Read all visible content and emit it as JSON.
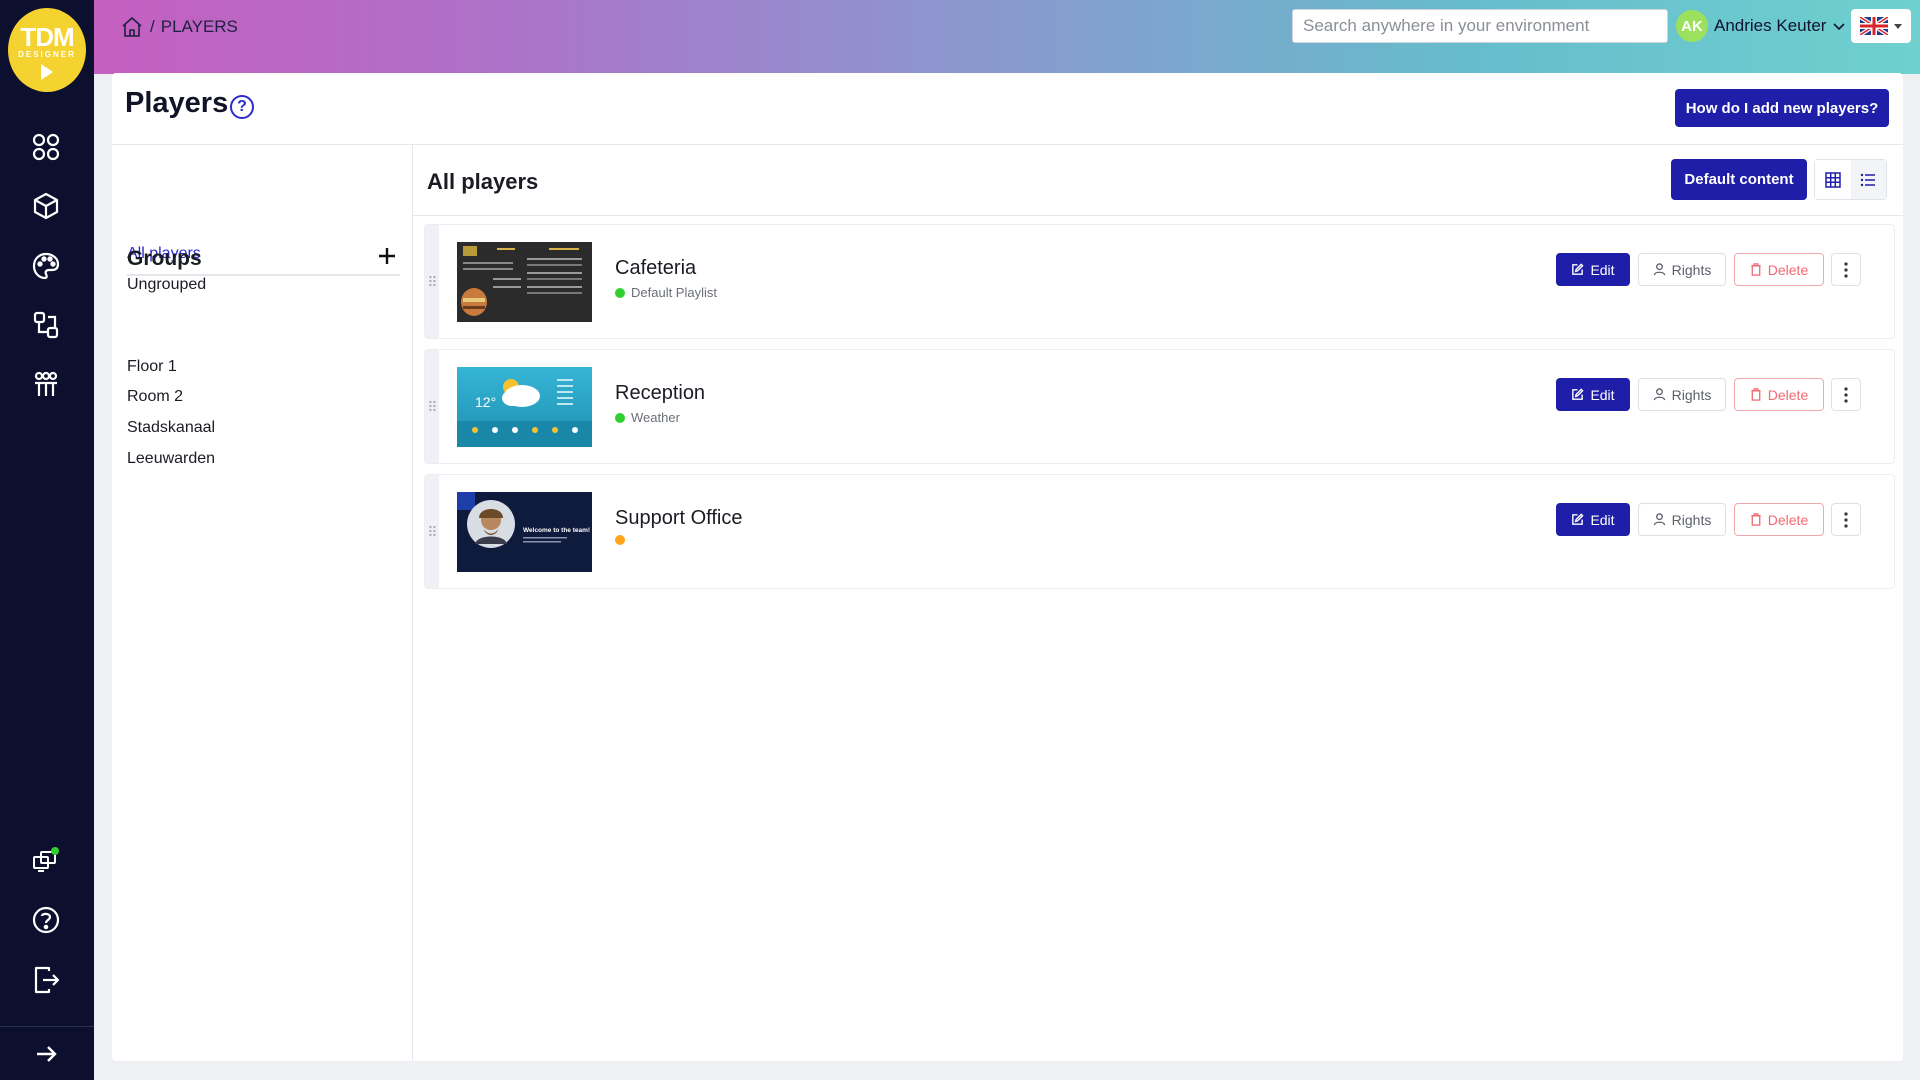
{
  "app": {
    "logo": {
      "line1": "TDM",
      "line2": "DESIGNER"
    },
    "breadcrumb": {
      "separator": "/",
      "current": "PLAYERS"
    },
    "search": {
      "placeholder": "Search anywhere in your environment",
      "value": ""
    },
    "user": {
      "initials": "AK",
      "name": "Andries Keuter"
    },
    "language": "en-GB"
  },
  "sidebar": {
    "items": [
      {
        "name": "dashboard",
        "icon": "grid-circles-icon"
      },
      {
        "name": "content",
        "icon": "cube-icon"
      },
      {
        "name": "design",
        "icon": "palette-icon"
      },
      {
        "name": "players",
        "icon": "players-icon"
      },
      {
        "name": "users",
        "icon": "team-icon"
      }
    ],
    "bottom": [
      {
        "name": "devices",
        "icon": "devices-status-icon"
      },
      {
        "name": "help",
        "icon": "help-circle-icon"
      },
      {
        "name": "logout",
        "icon": "logout-icon"
      }
    ],
    "expand_icon": "arrow-right-icon"
  },
  "page": {
    "title": "Players",
    "help_symbol": "?",
    "how_button": "How do I add new players?"
  },
  "left_nav": {
    "links": [
      {
        "label": "All players",
        "active": true
      },
      {
        "label": "Ungrouped",
        "active": false
      }
    ],
    "groups_title": "Groups",
    "groups": [
      "Floor 1",
      "Room 2",
      "Stadskanaal",
      "Leeuwarden"
    ]
  },
  "content": {
    "title": "All players",
    "default_button": "Default content",
    "view_mode": "list"
  },
  "players": [
    {
      "name": "Cafeteria",
      "status": "Default Playlist",
      "status_color": "#2fd12f",
      "thumb": "menu"
    },
    {
      "name": "Reception",
      "status": "Weather",
      "status_color": "#2fd12f",
      "thumb": "weather",
      "thumb_temp": "12°"
    },
    {
      "name": "Support Office",
      "status": "",
      "status_color": "#ffa41b",
      "thumb": "welcome",
      "thumb_text": "Welcome to the team!"
    }
  ],
  "row_actions": {
    "edit": "Edit",
    "rights": "Rights",
    "delete": "Delete"
  },
  "colors": {
    "primary": "#1e1ea8",
    "sidebar": "#0d0f2e",
    "danger": "#f16a73",
    "link": "#2b2bd0"
  }
}
